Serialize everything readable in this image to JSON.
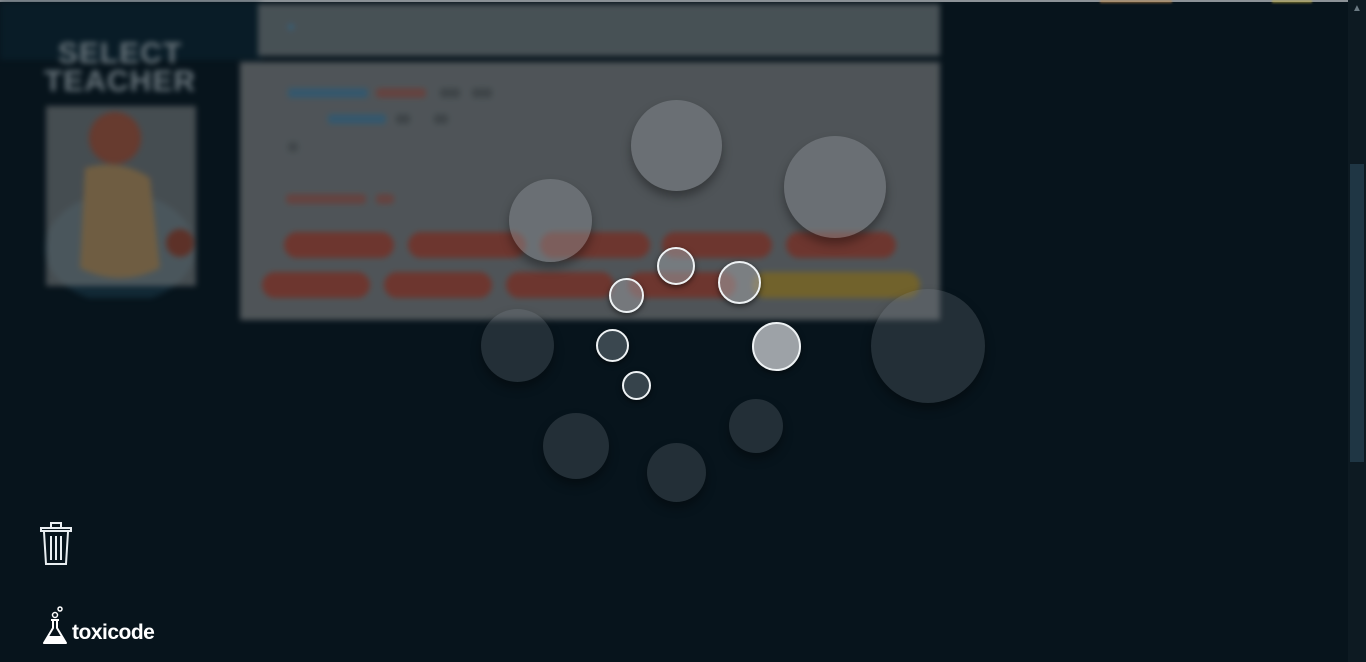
{
  "background_app": {
    "colors": {
      "editor": "#8a8a8a",
      "tab_bar": "#7d8385",
      "pill_red": "#c2533f",
      "pill_yellow": "#c9a23a"
    },
    "logo_lines": [
      "SELECT",
      "TEACHER"
    ]
  },
  "loading_spinner": {
    "state": "loading",
    "ring_count": 6,
    "blur_count": 10
  },
  "toolbar": {
    "trash_icon": "trash-icon"
  },
  "brand": {
    "name": "toxicode",
    "icon": "flask-icon"
  }
}
